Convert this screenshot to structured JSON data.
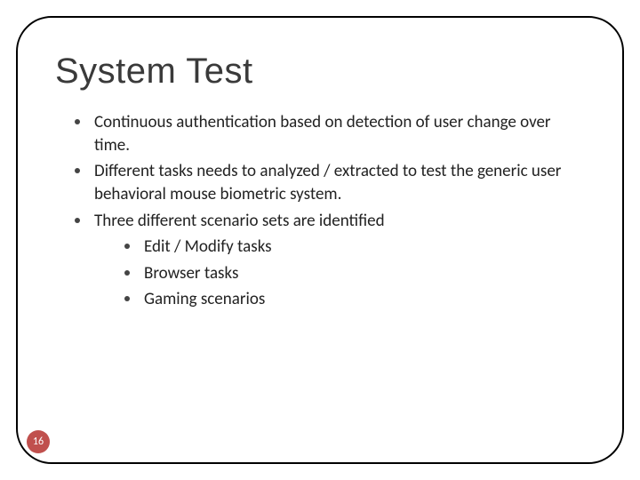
{
  "title": "System Test",
  "bullets": {
    "b1": "Continuous authentication based on detection of user change over time.",
    "b2": "Different tasks needs to analyzed / extracted to test the generic user behavioral mouse biometric system.",
    "b3": "Three different scenario sets are identified",
    "sub1": "Edit / Modify tasks",
    "sub2": "Browser tasks",
    "sub3": "Gaming scenarios"
  },
  "page_number": "16"
}
